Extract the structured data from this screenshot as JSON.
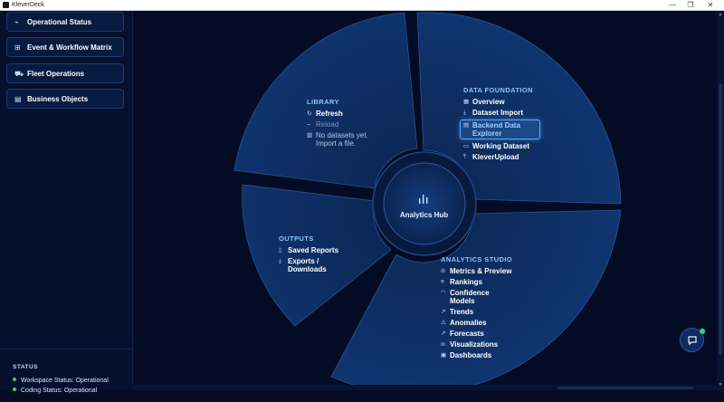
{
  "window": {
    "title": "KleverDeck",
    "controls": [
      "—",
      "❐",
      "✕"
    ]
  },
  "sidebar": {
    "items": [
      {
        "label": "Operational Status",
        "icon": "activity-icon",
        "glyph": "⌁"
      },
      {
        "label": "Event & Workflow Matrix",
        "icon": "grid-icon",
        "glyph": "⊞"
      },
      {
        "label": "Fleet Operations",
        "icon": "truck-icon",
        "glyph": "⛟"
      },
      {
        "label": "Business Objects",
        "icon": "document-icon",
        "glyph": "▤"
      }
    ],
    "status": {
      "title": "STATUS",
      "rows": [
        {
          "text": "Workspace Status: Operational",
          "color": "#2ed573"
        },
        {
          "text": "Coding Status: Operational",
          "color": "#2ed573"
        }
      ]
    }
  },
  "hub": {
    "label": "Analytics Hub",
    "icon": "bar-chart-icon"
  },
  "library": {
    "title": "LIBRARY",
    "items": [
      {
        "label": "Refresh",
        "icon": "refresh-icon",
        "glyph": "↻"
      },
      {
        "label": "Reload",
        "icon": "reload-icon",
        "glyph": "⌣"
      },
      {
        "label": "No datasets yet.",
        "label2": "Import a file.",
        "icon": "database-icon",
        "glyph": "▥"
      }
    ]
  },
  "data_foundation": {
    "title": "DATA FOUNDATION",
    "items": [
      {
        "label": "Overview",
        "icon": "overview-icon",
        "glyph": "▦"
      },
      {
        "label": "Dataset Import",
        "icon": "download-icon",
        "glyph": "⤓"
      },
      {
        "label": "Backend Data",
        "label2": "Explorer",
        "icon": "database-icon",
        "glyph": "▤"
      },
      {
        "label": "Working Dataset",
        "icon": "table-icon",
        "glyph": "▭"
      },
      {
        "label": "KleverUpload",
        "icon": "upload-icon",
        "glyph": "⤒"
      }
    ]
  },
  "outputs": {
    "title": "OUTPUTS",
    "items": [
      {
        "label": "Saved Reports",
        "icon": "file-icon",
        "glyph": "▯"
      },
      {
        "label": "Exports /",
        "label2": "Downloads",
        "icon": "download-icon",
        "glyph": "⤓"
      }
    ]
  },
  "analytics_studio": {
    "title": "ANALYTICS STUDIO",
    "items": [
      {
        "label": "Metrics & Preview",
        "icon": "metrics-icon",
        "glyph": "ılı"
      },
      {
        "label": "Rankings",
        "icon": "list-icon",
        "glyph": "≡"
      },
      {
        "label": "Confidence",
        "label2": "Models",
        "icon": "gauge-icon",
        "glyph": "◠"
      },
      {
        "label": "Trends",
        "icon": "trend-icon",
        "glyph": "↗"
      },
      {
        "label": "Anomalies",
        "icon": "warning-icon",
        "glyph": "⚠"
      },
      {
        "label": "Forecasts",
        "icon": "forecast-icon",
        "glyph": "↗"
      },
      {
        "label": "Visualizations",
        "icon": "chart-icon",
        "glyph": "ılı"
      },
      {
        "label": "Dashboards",
        "icon": "dashboard-icon",
        "glyph": "▣"
      }
    ]
  },
  "chat": {
    "icon": "chat-icon",
    "badge_color": "#2ed573"
  },
  "colors": {
    "background": "#030c24",
    "segment": "#0f2f66",
    "accent": "#8cc6ff",
    "status_ok": "#2ed573"
  }
}
